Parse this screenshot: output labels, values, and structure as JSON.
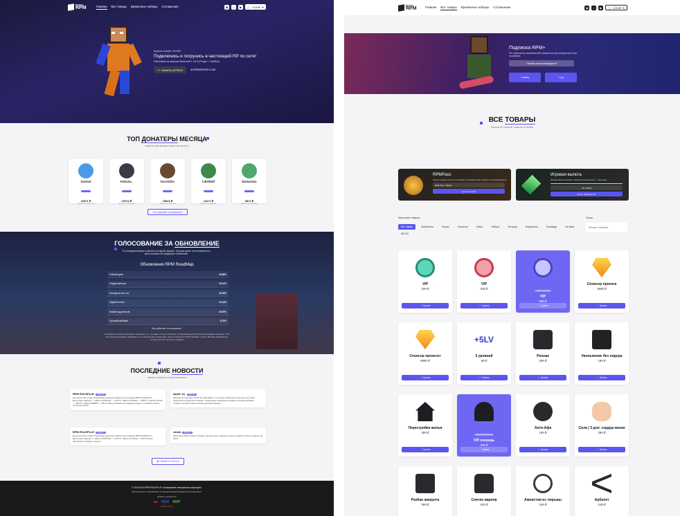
{
  "left": {
    "nav": {
      "logo_small": "ИГРАТЬ",
      "logo": "RPM",
      "links": [
        "Главная",
        "Все товары",
        "Временные наборы",
        "Соглашение"
      ],
      "cart": "0.00 ₽"
    },
    "hero": {
      "online": "Игроков онлайн: 237/250",
      "title": "Подключись и погрузись в настоящий RP по сети!",
      "subtitle": "Работаем на версии Minecraft 1.16.5 (Forge + Optifine)",
      "start_button": "НАЧАТЬ ИГРАТЬ",
      "ip": "RPMSERVER.COM"
    },
    "donors": {
      "title_a": "ТОП ",
      "title_b": "ДОНАТЕРЫ",
      "title_c": " МЕСЯЦА",
      "subtitle": "наибольший вклад в развитие проекта",
      "items": [
        {
          "name": "SaVraZ",
          "sum": "16871 ₽",
          "label": "ДОНАТ ЗА МЕСЯЦ",
          "color": "#4a9de4"
        },
        {
          "name": "ItsKana_",
          "sum": "15764 ₽",
          "label": "ДОНАТ ЗА МЕСЯЦ",
          "color": "#3a3a44"
        },
        {
          "name": "kovv220v",
          "sum": "15603 ₽",
          "label": "ДОНАТ ЗА МЕСЯЦ",
          "color": "#6a4a30"
        },
        {
          "name": "LikeWolf",
          "sum": "12672 ₽",
          "label": "ДОНАТ ЗА МЕСЯЦ",
          "color": "#3e8a4a"
        },
        {
          "name": "Domantas",
          "sum": "9874 ₽",
          "label": "ДОНАТ ЗА МЕСЯЦ",
          "color": "#4ea86a"
        }
      ],
      "more_button": "Что получает топ донатер?"
    },
    "vote": {
      "title_a": "ГОЛОСОВАНИЕ ЗА ",
      "title_b": "ОБНОВЛЕНИЕ",
      "subtitle": "Ты напрямую можешь повлиять на судьбу сервера. Покупая донат, есть возможность проголосовать за следующее обновление",
      "roadmap": "Обновления RPM RoadMap",
      "rows": [
        {
          "label": "Рыбный день",
          "pct": "29.88%"
        },
        {
          "label": "Сердечный пусс",
          "pct": "15.41%"
        },
        {
          "label": "Мотоциклы вне гос",
          "pct": "16.35%"
        },
        {
          "label": "Ледяной сезон",
          "pct": "10.13%"
        },
        {
          "label": "Новый год детектив",
          "pct": "20.87%"
        },
        {
          "label": "Пуловый выбивон",
          "pct": "6.78%"
        }
      ],
      "how_it_works": "Как работает голосование?",
      "note": "В журнале не можно прописать как вижок, то, что нами ли проголосовали, за обновление, Чем больше гражданин покупает, тем больше баллов будет добавлено к его-обновлению. Например, донат стоимостью 100 ₽ добавит 1 балл. Выбери обновление, которое хочешь получить первым!"
    },
    "news": {
      "title_a": "ПОСЛЕДНИЕ ",
      "title_b": "НОВОСТИ",
      "subtitle": "новости проекта из Discord-канала",
      "items": [
        {
          "author": "RPM ROLEPLAY",
          "tag": "#Новости",
          "text": "@everyone Во славу обновления донатные наборы для сервера RPM ROLEPLAY! Доступные наборы: 1. Набор ХИТАКСЕ — 149 ₽ 2. Набор КУТЕЖА — 299 ₽ 3. Набор КОТЛА — 349 ₽ 4. Набор МАФИИ — 299 ₽ Набор обновляется каждую неделю. Успевайте купить до конца сезона."
        },
        {
          "author": "takeff_he",
          "tag": "#Новости",
          "text": "@everyone Гуд кофе! 10:00 Не забывайте, что выход обновления повлечет за собой изменения в донатных наборах. Следующее обновление выйдет в скором времени. Следите за новостями в нашем дискорд-сервере."
        },
        {
          "author": "RPM ROLEPLAY",
          "tag": "#Новости",
          "text": "@everyone Во славу обновления донатные наборы для сервера RPM ROLEPLAY! Доступные наборы: 1. Набор ХИТАКСЕ — 149 ₽ 2. Набор КУТЕЖА — 299 ₽ Набор обновляется каждую неделю."
        },
        {
          "author": "nikvik",
          "tag": "#Новости",
          "text": "@everyone Всем привет! Сервер уже доступен, заходите играть. Новости скоро появятся на сайте."
        }
      ],
      "discord_button": "Перейти в Discord"
    },
    "footer": {
      "copyright": "© 2018-2024 RPM ROLEPLAY. Копирование материалов запрещено.",
      "line2": "RPM ROLEPLAY НЕ ЯВЛЯЕТСЯ ОФИЦИАЛЬНЫМ ПРОДУКТОМ MINECRAFT",
      "dev": "Дизайн и разработка",
      "pay": [
        "VISA",
        "МИР",
        "FREEKASSA"
      ]
    }
  },
  "right": {
    "subscription": {
      "title": "Подписка RPM+",
      "text": "30+ уникальных возможностей, привилегии для комфортной игры на сервере",
      "features_btn": "Полный список преимуществ",
      "plan1": "1 месяц",
      "plan2": "1 год"
    },
    "catalog": {
      "title_a": "ВСЕ ",
      "title_b": "ТОВАРЫ",
      "subtitle": "больше 60 позиций товаров на выбор"
    },
    "rpmpass": {
      "title": "RPMPass",
      "text": "Получи награды за игру на сервере. Открывай новые уровни и получай предметы",
      "select": "RPM Pass / Тариф",
      "button": "Купить за 10 ₽"
    },
    "currency": {
      "title": "Игровая валюта",
      "text": "Игровая валюта проекта. Покупать больше монет — выгоднее",
      "amount": "1 ₽ = 800 $",
      "button": "Купить 4000 $ за 5 ₽"
    },
    "filters": {
      "label": "Категории товаров",
      "search_label": "Поиск",
      "search_placeholder": "Введите название",
      "cats": [
        "Все товары",
        "Привилегии",
        "Бонусы",
        "Транспорт",
        "Кейсы",
        "Наборы",
        "Питомцы",
        "Фермерство",
        "Пеповиды",
        "На заказ",
        "ВЕСНА"
      ]
    },
    "products": [
      {
        "name": "VIP",
        "price": "199 ₽",
        "btn": "Купить",
        "hl": false,
        "icon": "vip-teal-icon"
      },
      {
        "name": "VIP",
        "price": "349 ₽",
        "btn": "Купить",
        "hl": false,
        "icon": "vip-red-icon"
      },
      {
        "name": "VIP",
        "price": "699 ₽",
        "btn": "Купить",
        "hl": true,
        "tag": "Самая выгодная",
        "icon": "vip-purple-icon"
      },
      {
        "name": "Спонсор проекта",
        "price": "3999 ₽",
        "btn": "Купить",
        "hl": false,
        "icon": "diamond-icon"
      },
      {
        "name": "Спонсор проекта+",
        "price": "9999 ₽",
        "btn": "Купить",
        "hl": false,
        "icon": "diamond-plus-icon"
      },
      {
        "name": "5 уровней",
        "price": "99 ₽",
        "btn": "Купить",
        "hl": false,
        "icon": "levels-icon"
      },
      {
        "name": "Рюкзак",
        "price": "299 ₽",
        "btn": "Купить",
        "hl": false,
        "icon": "backpack-icon"
      },
      {
        "name": "Увольнение без лидера",
        "price": "199 ₽",
        "btn": "Купить",
        "hl": false,
        "icon": "fire-icon"
      },
      {
        "name": "Перестройка жилья",
        "price": "399 ₽",
        "btn": "Купить",
        "hl": false,
        "icon": "house-icon"
      },
      {
        "name": "VIP очередь",
        "price": "199 ₽",
        "btn": "Купить",
        "hl": true,
        "tag": "Самый популярный",
        "icon": "queue-icon"
      },
      {
        "name": "Анти-Афк",
        "price": "199 ₽",
        "btn": "Купить",
        "hl": false,
        "icon": "sleep-icon"
      },
      {
        "name": "Сила | 3 доп. сердца жизни",
        "price": "299 ₽",
        "btn": "Купить",
        "hl": false,
        "icon": "muscle-icon"
      },
      {
        "name": "Разбан аккаунта",
        "price": "399 ₽",
        "btn": "Купить",
        "hl": false,
        "icon": "lock-icon"
      },
      {
        "name": "Снятие варнов",
        "price": "249 ₽",
        "btn": "Купить",
        "hl": false,
        "icon": "fire-ext-icon"
      },
      {
        "name": "Амнистия из тюрьмы",
        "price": "249 ₽",
        "btn": "Купить",
        "hl": false,
        "icon": "handcuffs-icon"
      },
      {
        "name": "Арбалет",
        "price": "249 ₽",
        "btn": "Купить",
        "hl": false,
        "icon": "crossbow-icon"
      }
    ]
  }
}
